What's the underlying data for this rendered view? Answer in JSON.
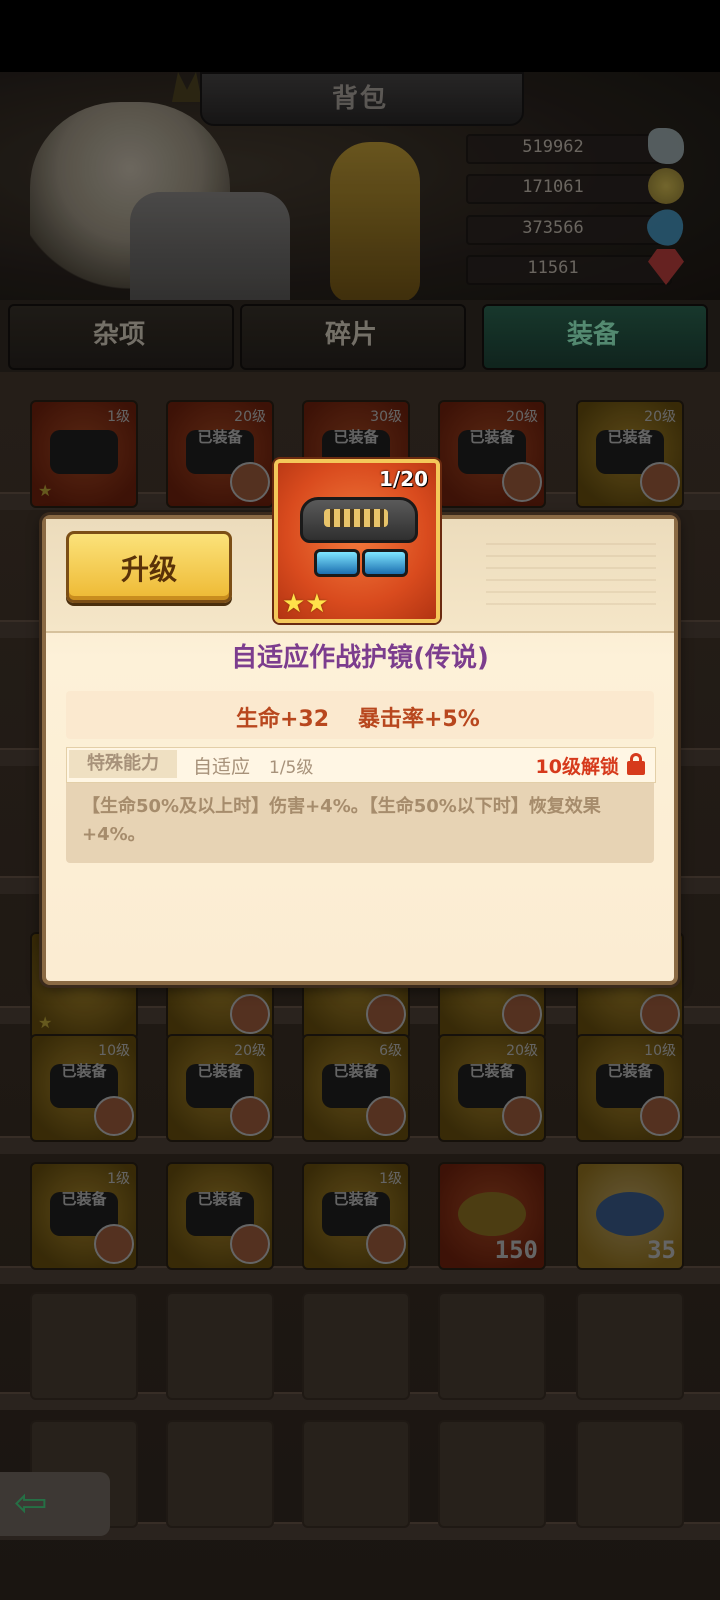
{
  "header": {
    "title": "背包"
  },
  "resources": [
    {
      "value": "519962",
      "icon": "stone-icon"
    },
    {
      "value": "171061",
      "icon": "coin-icon"
    },
    {
      "value": "373566",
      "icon": "water-drop-icon"
    },
    {
      "value": "11561",
      "icon": "red-gem-icon"
    }
  ],
  "tabs": [
    {
      "label": "杂项",
      "active": false
    },
    {
      "label": "碎片",
      "active": false
    },
    {
      "label": "装备",
      "active": true
    }
  ],
  "inventory": {
    "row1": [
      {
        "level": "1级",
        "badge": ""
      },
      {
        "level": "20级",
        "badge": "已装备"
      },
      {
        "level": "30级",
        "badge": "已装备"
      },
      {
        "level": "20级",
        "badge": "已装备"
      },
      {
        "level": "20级",
        "badge": "已装备"
      }
    ],
    "row6": [
      {
        "level": "10级",
        "badge": "已装备"
      },
      {
        "level": "20级",
        "badge": "已装备"
      },
      {
        "level": "6级",
        "badge": "已装备"
      },
      {
        "level": "20级",
        "badge": "已装备"
      },
      {
        "level": "10级",
        "badge": "已装备"
      }
    ],
    "row7": [
      {
        "level": "1级",
        "badge": "已装备"
      },
      {
        "level": "",
        "badge": "已装备"
      },
      {
        "level": "1级",
        "badge": "已装备"
      },
      {
        "count": "150"
      },
      {
        "count": "35"
      }
    ]
  },
  "modal": {
    "upgrade_label": "升级",
    "item_level": "1/20",
    "item_name": "自适应作战护镜(传说)",
    "stats": {
      "hp": "生命+32",
      "crit": "暴击率+5%"
    },
    "special": {
      "tag": "特殊能力",
      "name": "自适应",
      "level": "1/5级",
      "unlock": "10级解锁"
    },
    "description": "【生命50%及以上时】伤害+4%。【生命50%以下时】恢复效果+4%。"
  },
  "colors": {
    "item_name": "#7c3d8e",
    "stat": "#b8471e",
    "unlock": "#d63a1c",
    "upgrade_button": "#eeb933"
  }
}
